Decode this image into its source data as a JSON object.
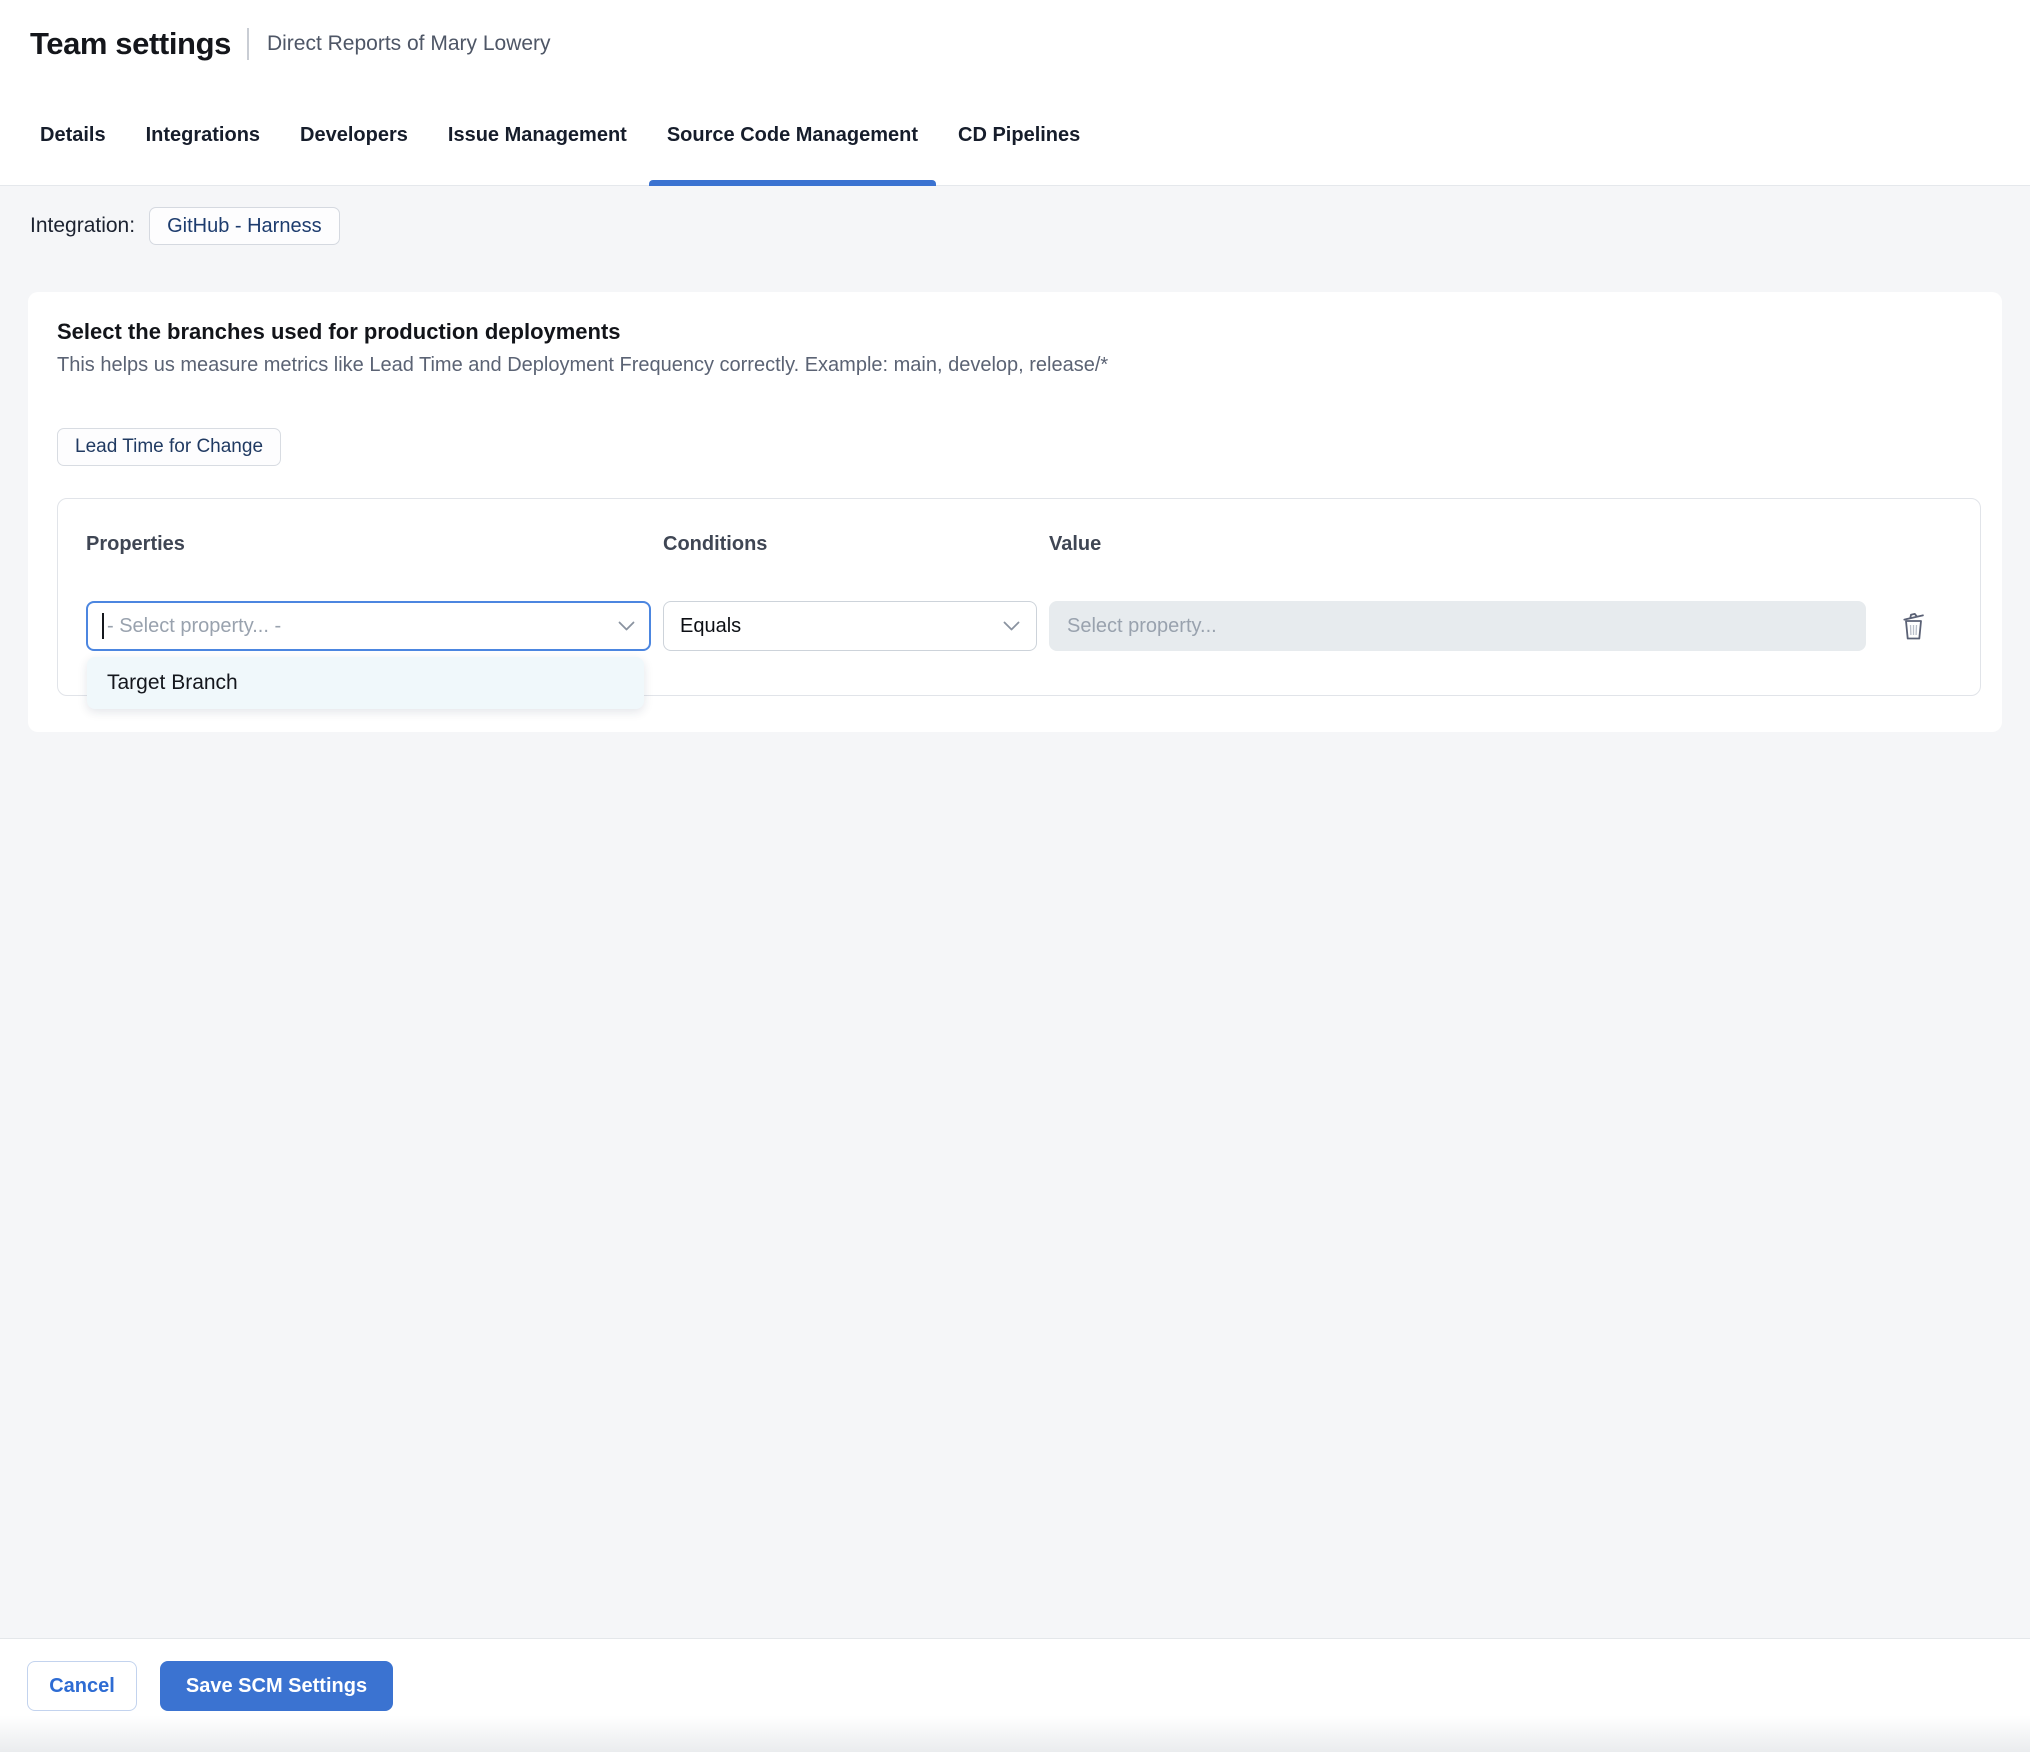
{
  "header": {
    "title": "Team settings",
    "subtitle": "Direct Reports of Mary Lowery"
  },
  "tabs": [
    {
      "label": "Details",
      "active": false
    },
    {
      "label": "Integrations",
      "active": false
    },
    {
      "label": "Developers",
      "active": false
    },
    {
      "label": "Issue Management",
      "active": false
    },
    {
      "label": "Source Code Management",
      "active": true
    },
    {
      "label": "CD Pipelines",
      "active": false
    }
  ],
  "integration": {
    "label": "Integration:",
    "chip": "GitHub - Harness"
  },
  "card": {
    "heading": "Select the branches used for production deployments",
    "description": "This helps us measure metrics like Lead Time and Deployment Frequency correctly. Example: main, develop, release/*",
    "metric_chip": "Lead Time for Change",
    "columns": {
      "properties": "Properties",
      "conditions": "Conditions",
      "value": "Value"
    },
    "property_select": {
      "placeholder": "- Select property... -"
    },
    "condition_select": {
      "value": "Equals"
    },
    "value_input": {
      "placeholder": "Select property..."
    },
    "dropdown_options": [
      "Target Branch"
    ]
  },
  "footer": {
    "cancel": "Cancel",
    "save": "Save SCM Settings"
  },
  "colors": {
    "accent_blue": "#3b73d1",
    "focus_border": "#4c86e0",
    "navy_text": "#1d3c6e",
    "page_bg": "#f5f6f8",
    "disabled_input_bg": "#e7ebee",
    "dropdown_bg": "#f0f8fb"
  }
}
